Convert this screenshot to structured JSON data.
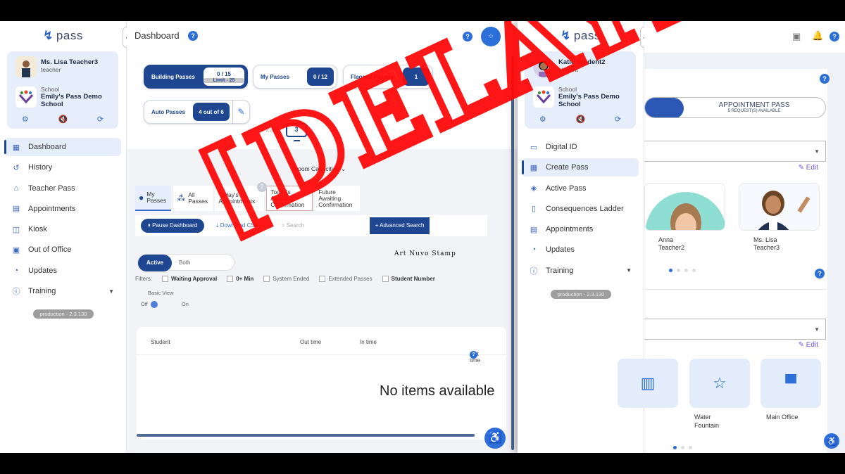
{
  "left_app": {
    "logo": "pass",
    "user": {
      "name": "Ms. Lisa Teacher3",
      "role": "teacher"
    },
    "school": {
      "label": "School",
      "name": "Emily's Pass Demo School"
    },
    "nav": [
      {
        "label": "Dashboard",
        "icon": "dashboard-icon",
        "active": true
      },
      {
        "label": "History",
        "icon": "history-icon"
      },
      {
        "label": "Teacher Pass",
        "icon": "door-icon"
      },
      {
        "label": "Appointments",
        "icon": "calendar-icon"
      },
      {
        "label": "Kiosk",
        "icon": "kiosk-icon"
      },
      {
        "label": "Out of Office",
        "icon": "briefcase-icon"
      },
      {
        "label": "Updates",
        "icon": "updates-icon"
      },
      {
        "label": "Training",
        "icon": "info-icon"
      }
    ],
    "version": "production - 2.3.130",
    "header": {
      "title": "Dashboard"
    },
    "pass_cards": {
      "building": {
        "label": "Building Passes",
        "value": "0 / 15",
        "limit": "Limit - 25"
      },
      "my": {
        "label": "My Passes",
        "value": "0 / 12"
      },
      "flagged": {
        "label": "Flagged Passes",
        "value": "1"
      },
      "auto": {
        "label": "Auto Passes",
        "value": "4 out of 6"
      }
    },
    "kiosk": {
      "label": "Kiosk",
      "count": "3"
    },
    "room_capacities": "Room Capacities",
    "tabs": [
      {
        "label": "My Passes"
      },
      {
        "label": "All Passes"
      },
      {
        "label": "Today's Appointments",
        "badge": "2"
      },
      {
        "label": "Today's Awaiting Confirmation"
      },
      {
        "label": "Future Awaiting Confirmation"
      }
    ],
    "toolbar": {
      "pause": "Pause Dashboard",
      "csv": "Download CSV",
      "search_placeholder": "Search",
      "advanced": "+ Advanced Search"
    },
    "segment": {
      "active": "Active",
      "other": "Both"
    },
    "filters": {
      "label": "Filters:",
      "items": [
        "Waiting Approval",
        "0+ Min",
        "System Ended",
        "Extended Passes",
        "Student Number"
      ]
    },
    "basic_view": "Basic View",
    "toggle": {
      "off": "Off",
      "on": "On"
    },
    "table": {
      "columns": [
        "Student",
        "Out time",
        "In time",
        "Out time"
      ],
      "empty": "No items available"
    }
  },
  "right_app": {
    "logo": "pass",
    "user": {
      "name": "Katie Student2",
      "role": "student"
    },
    "school": {
      "label": "School",
      "name": "Emily's Pass Demo School"
    },
    "nav": [
      {
        "label": "Digital ID"
      },
      {
        "label": "Create Pass",
        "active": true
      },
      {
        "label": "Active Pass"
      },
      {
        "label": "Consequences Ladder"
      },
      {
        "label": "Appointments"
      },
      {
        "label": "Updates"
      },
      {
        "label": "Training"
      }
    ],
    "version": "production - 2.3.130",
    "appointment_pass": {
      "title": "APPOINTMENT PASS",
      "subtitle": "5 REQUEST(S) AVAILABLE"
    },
    "edit": "Edit",
    "teachers": [
      {
        "name": "Anna Teacher2"
      },
      {
        "name": "Ms. Lisa Teacher3"
      }
    ],
    "rooms": [
      {
        "name": "",
        "icon": "locker-icon"
      },
      {
        "name": "Water Fountain",
        "icon": "star-icon"
      },
      {
        "name": "Main Office",
        "icon": "desk-icon"
      }
    ]
  },
  "overlay": {
    "stamp": "[DELAYED]",
    "stamp_credit": "Art Nuvo Stamp"
  },
  "colors": {
    "primary": "#1f4690",
    "accent": "#2d6fd9",
    "stamp": "#ff0a0a"
  }
}
